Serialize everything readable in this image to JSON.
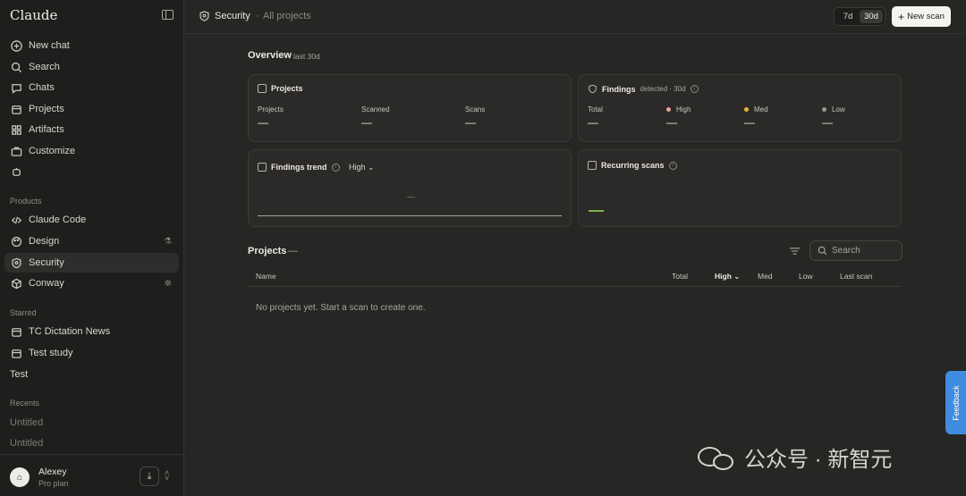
{
  "app": {
    "brand": "Claude"
  },
  "sidebar": {
    "top_items": [
      {
        "label": "New chat",
        "icon": "plus-circle-icon"
      },
      {
        "label": "Search",
        "icon": "search-icon"
      },
      {
        "label": "Chats",
        "icon": "chat-bubble-icon"
      },
      {
        "label": "Projects",
        "icon": "folder-icon"
      },
      {
        "label": "Artifacts",
        "icon": "artifacts-icon"
      },
      {
        "label": "Customize",
        "icon": "briefcase-icon"
      }
    ],
    "products_label": "Products",
    "products": [
      {
        "label": "Claude Code",
        "icon": "code-icon"
      },
      {
        "label": "Design",
        "icon": "palette-icon"
      },
      {
        "label": "Security",
        "icon": "shield-icon"
      },
      {
        "label": "Conway",
        "icon": "cube-icon"
      }
    ],
    "starred_label": "Starred",
    "starred": [
      {
        "label": "TC Dictation News",
        "icon": "folder-icon"
      },
      {
        "label": "Test study",
        "icon": "folder-icon"
      },
      {
        "label": "Test"
      }
    ],
    "recents_label": "Recents",
    "recents": [
      "Untitled",
      "Untitled"
    ],
    "user": {
      "initial": "⌂",
      "name": "Alexey",
      "plan": "Pro plan"
    }
  },
  "header": {
    "title": "Security",
    "separator": "·",
    "subtitle": "All projects",
    "ranges": [
      "7d",
      "30d"
    ],
    "selected_range": "30d",
    "new_scan_label": "New scan"
  },
  "overview": {
    "title": "Overview",
    "subtitle": "last 30d",
    "projects_card": {
      "title": "Projects",
      "stats": [
        {
          "label": "Projects",
          "value": "—"
        },
        {
          "label": "Scanned",
          "value": "—"
        },
        {
          "label": "Scans",
          "value": "—"
        }
      ]
    },
    "findings_card": {
      "title": "Findings",
      "extra": "detected · 30d",
      "stats": [
        {
          "label": "Total",
          "value": "—"
        },
        {
          "label": "High",
          "value": "—",
          "color": "#e8a39a"
        },
        {
          "label": "Med",
          "value": "—",
          "color": "#e8b43a"
        },
        {
          "label": "Low",
          "value": "—",
          "color": "#9a9893"
        }
      ]
    },
    "trend_card": {
      "title": "Findings trend",
      "severity": "High",
      "placeholder": "—"
    },
    "recurring_card": {
      "title": "Recurring scans"
    }
  },
  "projects_table": {
    "title": "Projects",
    "count": "—",
    "search_placeholder": "Search",
    "columns": [
      "Name",
      "Total",
      "High",
      "Med",
      "Low",
      "Last scan"
    ],
    "empty_message": "No projects yet. Start a scan to create one."
  },
  "feedback_label": "Feedback",
  "watermark": "公众号 · 新智元"
}
